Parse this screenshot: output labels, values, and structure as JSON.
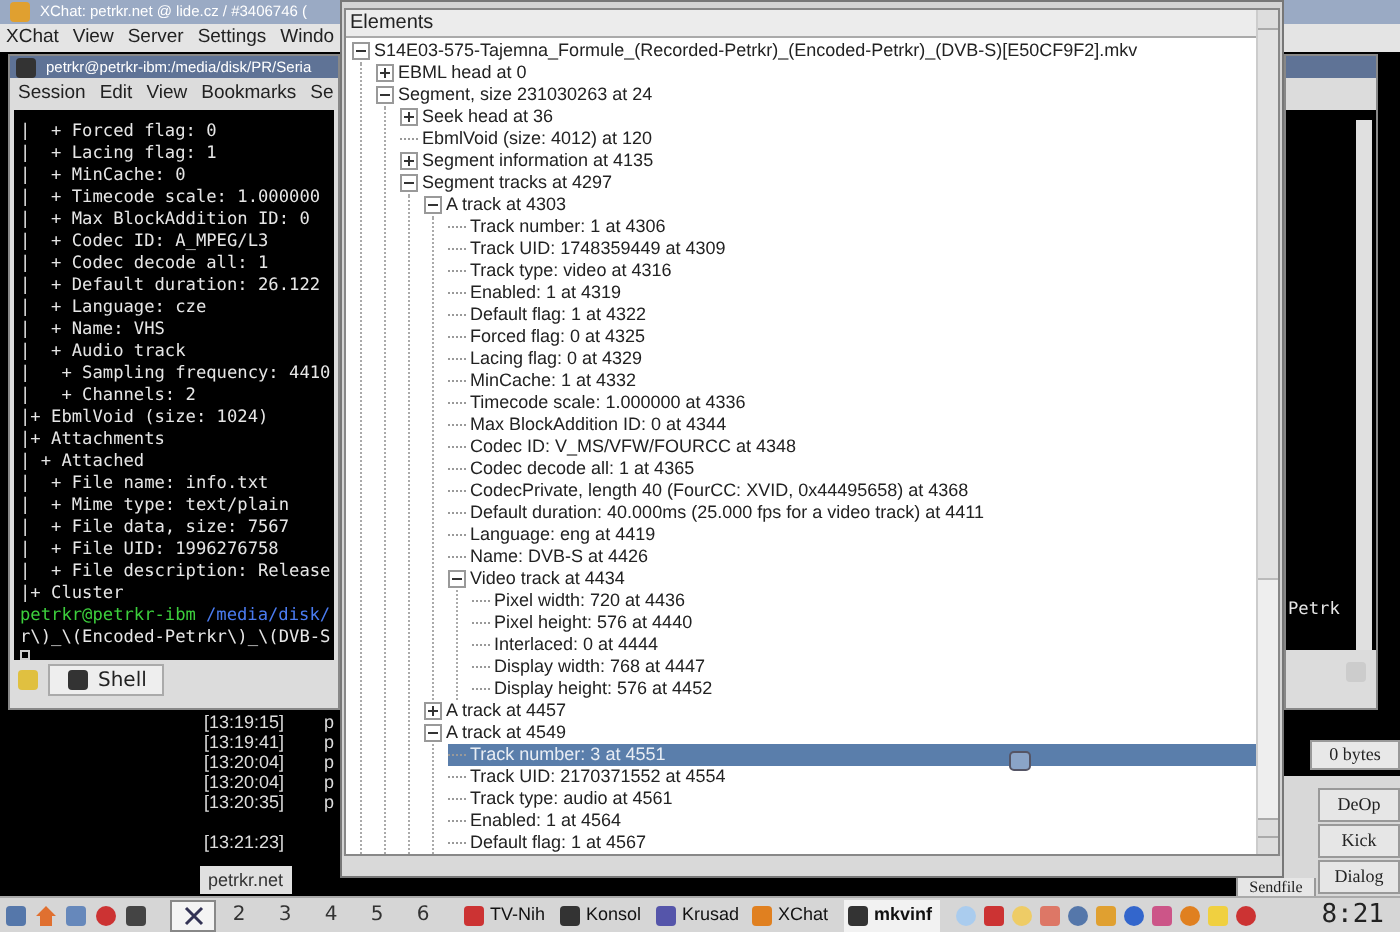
{
  "xchat": {
    "title": "XChat: petrkr.net @ lide.cz / #3406746 (",
    "menu": [
      "XChat",
      "View",
      "Server",
      "Settings",
      "Windo"
    ],
    "chat": [
      {
        "time": "[13:19:15]",
        "nick": "p"
      },
      {
        "time": "[13:19:41]",
        "nick": "p"
      },
      {
        "time": "[13:20:04]",
        "nick": "p"
      },
      {
        "time": "[13:20:04]",
        "nick": "p"
      },
      {
        "time": "[13:20:35]",
        "nick": "p"
      },
      {
        "time": "[13:21:23]"
      }
    ],
    "tab": "petrkr.net",
    "transfer": "0 bytes",
    "buttons": [
      "DeOp",
      "Kick",
      "Dialog"
    ],
    "sendfile": "Sendfile"
  },
  "konsole": {
    "title": "petrkr@petrkr-ibm:/media/disk/PR/Seria",
    "menu": [
      "Session",
      "Edit",
      "View",
      "Bookmarks",
      "Se"
    ],
    "lines": [
      "|  + Forced flag: 0",
      "|  + Lacing flag: 1",
      "|  + MinCache: 0",
      "|  + Timecode scale: 1.000000",
      "|  + Max BlockAddition ID: 0",
      "|  + Codec ID: A_MPEG/L3",
      "|  + Codec decode all: 1",
      "|  + Default duration: 26.122",
      "|  + Language: cze",
      "|  + Name: VHS",
      "|  + Audio track",
      "|   + Sampling frequency: 4410",
      "|   + Channels: 2",
      "|+ EbmlVoid (size: 1024)",
      "|+ Attachments",
      "| + Attached",
      "|  + File name: info.txt",
      "|  + Mime type: text/plain",
      "|  + File data, size: 7567",
      "|  + File UID: 1996276758",
      "|  + File description: Release",
      "|+ Cluster"
    ],
    "prompt": {
      "user": "petrkr@petrkr-ibm",
      "path": "/media/disk/"
    },
    "continuation": "r\\)_\\(Encoded-Petrkr\\)_\\(DVB-S",
    "right_fragment": "Petrk",
    "tab": "Shell"
  },
  "mkvinfo": {
    "header": "Elements",
    "tree": [
      {
        "label": "S14E03-575-Tajemna_Formule_(Recorded-Petrkr)_(Encoded-Petrkr)_(DVB-S)[E50CF9F2].mkv",
        "selected": false,
        "expanded": true,
        "children": [
          {
            "label": "EBML head at 0",
            "selected": false,
            "expanded": false
          },
          {
            "label": "Segment, size 231030263 at 24",
            "selected": false,
            "expanded": true,
            "children": [
              {
                "label": "Seek head at 36",
                "selected": false,
                "expanded": false
              },
              {
                "label": "EbmlVoid (size: 4012) at 120",
                "selected": false
              },
              {
                "label": "Segment information at 4135",
                "selected": false,
                "expanded": false
              },
              {
                "label": "Segment tracks at 4297",
                "selected": false,
                "expanded": true,
                "children": [
                  {
                    "label": "A track at 4303",
                    "selected": false,
                    "expanded": true,
                    "children": [
                      {
                        "label": "Track number: 1 at 4306",
                        "selected": false
                      },
                      {
                        "label": "Track UID: 1748359449 at 4309",
                        "selected": false
                      },
                      {
                        "label": "Track type: video at 4316",
                        "selected": false
                      },
                      {
                        "label": "Enabled: 1 at 4319",
                        "selected": false
                      },
                      {
                        "label": "Default flag: 1 at 4322",
                        "selected": false
                      },
                      {
                        "label": "Forced flag: 0 at 4325",
                        "selected": false
                      },
                      {
                        "label": "Lacing flag: 0 at 4329",
                        "selected": false
                      },
                      {
                        "label": "MinCache: 1 at 4332",
                        "selected": false
                      },
                      {
                        "label": "Timecode scale: 1.000000 at 4336",
                        "selected": false
                      },
                      {
                        "label": "Max BlockAddition ID: 0 at 4344",
                        "selected": false
                      },
                      {
                        "label": "Codec ID: V_MS/VFW/FOURCC at 4348",
                        "selected": false
                      },
                      {
                        "label": "Codec decode all: 1 at 4365",
                        "selected": false
                      },
                      {
                        "label": "CodecPrivate, length 40 (FourCC: XVID, 0x44495658) at 4368",
                        "selected": false
                      },
                      {
                        "label": "Default duration: 40.000ms (25.000 fps for a video track) at 4411",
                        "selected": false
                      },
                      {
                        "label": "Language: eng at 4419",
                        "selected": false
                      },
                      {
                        "label": "Name: DVB-S at 4426",
                        "selected": false
                      },
                      {
                        "label": "Video track at 4434",
                        "selected": false,
                        "expanded": true,
                        "children": [
                          {
                            "label": "Pixel width: 720 at 4436",
                            "selected": false
                          },
                          {
                            "label": "Pixel height: 576 at 4440",
                            "selected": false
                          },
                          {
                            "label": "Interlaced: 0 at 4444",
                            "selected": false
                          },
                          {
                            "label": "Display width: 768 at 4447",
                            "selected": false
                          },
                          {
                            "label": "Display height: 576 at 4452",
                            "selected": false
                          }
                        ]
                      }
                    ]
                  },
                  {
                    "label": "A track at 4457",
                    "selected": false,
                    "expanded": false
                  },
                  {
                    "label": "A track at 4549",
                    "selected": false,
                    "expanded": true,
                    "children": [
                      {
                        "label": "Track number: 3 at 4551",
                        "selected": true
                      },
                      {
                        "label": "Track UID: 2170371552 at 4554",
                        "selected": false
                      },
                      {
                        "label": "Track type: audio at 4561",
                        "selected": false
                      },
                      {
                        "label": "Enabled: 1 at 4564",
                        "selected": false
                      },
                      {
                        "label": "Default flag: 1 at 4567",
                        "selected": false
                      }
                    ]
                  }
                ]
              }
            ]
          }
        ]
      }
    ]
  },
  "taskbar": {
    "desktops": [
      {
        "selected": true
      },
      {
        "label": "2",
        "selected": false
      },
      {
        "label": "3",
        "selected": false
      },
      {
        "label": "4",
        "selected": false
      },
      {
        "label": "5",
        "selected": false
      },
      {
        "label": "6",
        "selected": false
      }
    ],
    "tasks": [
      {
        "label": "TV-Nih",
        "selected": false
      },
      {
        "label": "Konsol",
        "selected": false
      },
      {
        "label": "Krusad",
        "selected": false
      },
      {
        "label": "XChat",
        "selected": false
      },
      {
        "label": "mkvinf",
        "selected": true
      }
    ],
    "clock": "8:21"
  }
}
